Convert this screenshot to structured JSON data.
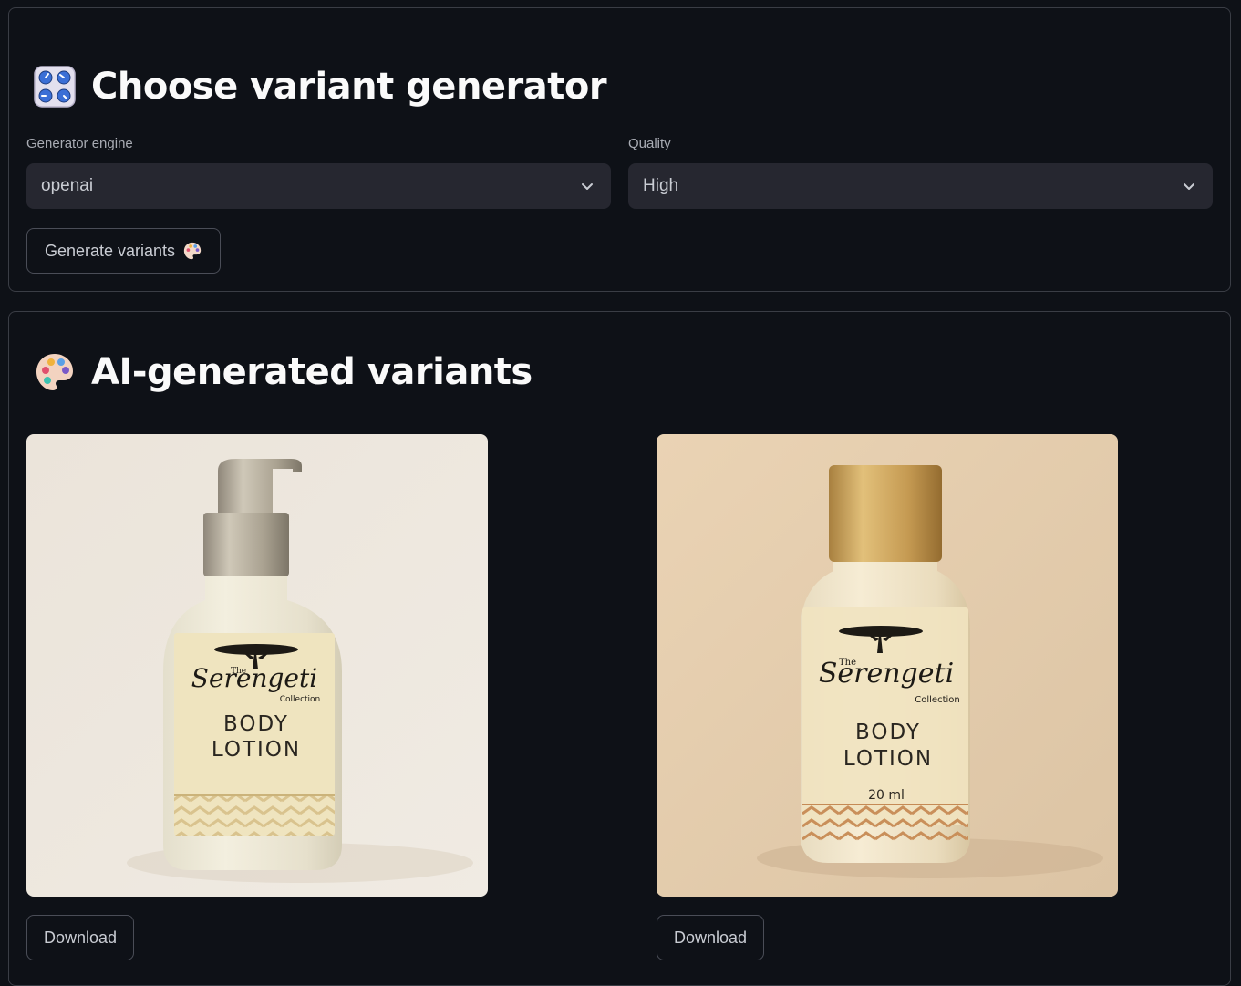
{
  "generator_section": {
    "title": "Choose variant generator",
    "icon": "control-knobs-icon",
    "engine_label": "Generator engine",
    "engine_value": "openai",
    "quality_label": "Quality",
    "quality_value": "High",
    "generate_button_label": "Generate variants"
  },
  "variants_section": {
    "title": "AI-generated variants",
    "icon": "artist-palette-icon",
    "variants": [
      {
        "brand_the": "The",
        "brand_name": "Serengeti",
        "brand_collection": "Collection",
        "product_line1": "BODY",
        "product_line2": "LOTION",
        "volume": "",
        "download_label": "Download"
      },
      {
        "brand_the": "The",
        "brand_name": "Serengeti",
        "brand_collection": "Collection",
        "product_line1": "BODY",
        "product_line2": "LOTION",
        "volume": "20 ml",
        "download_label": "Download"
      }
    ]
  },
  "colors": {
    "background": "#0e1117",
    "card_border": "#3a3d45",
    "select_bg": "#262730",
    "text": "#fafafa",
    "muted_text": "#a9acb4"
  }
}
